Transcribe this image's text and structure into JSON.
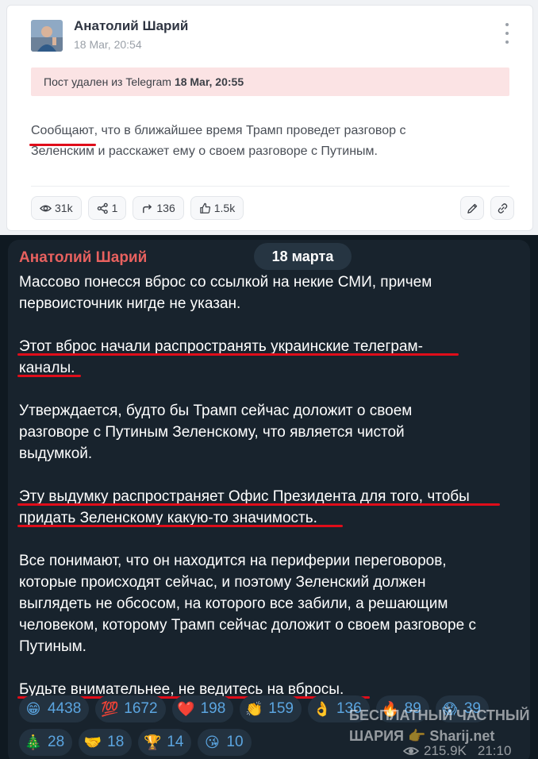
{
  "card": {
    "author": "Анатолий Шарий",
    "date": "18 Mar, 20:54",
    "deleted_prefix": "Пост удален из Telegram",
    "deleted_date": "18 Mar, 20:55",
    "text_underlined": "Сообщают",
    "text_rest_line1": ", что в ближайшее время Трамп проведет разговор с",
    "text_line2": "Зеленским и расскажет ему о своем разговоре с Путиным.",
    "stats": {
      "views": "31k",
      "forwards": "1",
      "shares": "136",
      "likes": "1.5k"
    },
    "icons": {
      "views": "eye-icon",
      "forwards": "network-icon",
      "shares": "share-arrow-icon",
      "likes": "thumbs-up-icon",
      "edit": "pencil-icon",
      "link": "link-icon",
      "menu": "more-vertical-icon"
    }
  },
  "telegram": {
    "author": "Анатолий Шарий",
    "date_pill": "18 марта",
    "paragraphs": [
      [
        "Массово понесся вброс со ссылкой на некие СМИ, причем",
        "первоисточник нигде не указан."
      ],
      [
        "Этот вброс начали распространять украинские телеграм-",
        "каналы."
      ],
      [
        "Утверждается, будто бы Трамп сейчас доложит о своем",
        "разговоре с Путиным Зеленскому, что является чистой",
        "выдумкой."
      ],
      [
        "Эту выдумку распространяет Офис Президента для того, чтобы",
        "придать Зеленскому какую-то значимость."
      ],
      [
        "Все понимают, что он находится на периферии переговоров,",
        "которые происходят сейчас, и поэтому Зеленский должен",
        "выглядеть не обсосом, на которого все забили, а решающим",
        "человеком, которому Трамп сейчас доложит о своем разговоре с",
        "Путиным."
      ],
      [
        "Будьте внимательнее, не ведитесь на вбросы."
      ]
    ],
    "reactions_row1": [
      {
        "emoji": "😁",
        "count": "4438"
      },
      {
        "emoji": "💯",
        "count": "1672"
      },
      {
        "emoji": "❤️",
        "count": "198"
      },
      {
        "emoji": "👏",
        "count": "159"
      },
      {
        "emoji": "👌",
        "count": "136"
      },
      {
        "emoji": "🔥",
        "count": "89"
      },
      {
        "emoji": "😱",
        "count": "39"
      }
    ],
    "reactions_row2": [
      {
        "emoji": "🎄",
        "count": "28"
      },
      {
        "emoji": "🤝",
        "count": "18"
      },
      {
        "emoji": "🏆",
        "count": "14"
      },
      {
        "emoji": "😘",
        "count": "10"
      }
    ],
    "watermark_line1": "БЕСПЛАТНЫЙ ЧАСТНЫЙ",
    "watermark_line2": "ШАРИЯ 👉 Sharij.net",
    "views": "215.9K",
    "time": "21:10",
    "colors": {
      "author": "#e8615f",
      "underline": "#e00d1a",
      "reaction_text": "#5ba5e0"
    }
  }
}
